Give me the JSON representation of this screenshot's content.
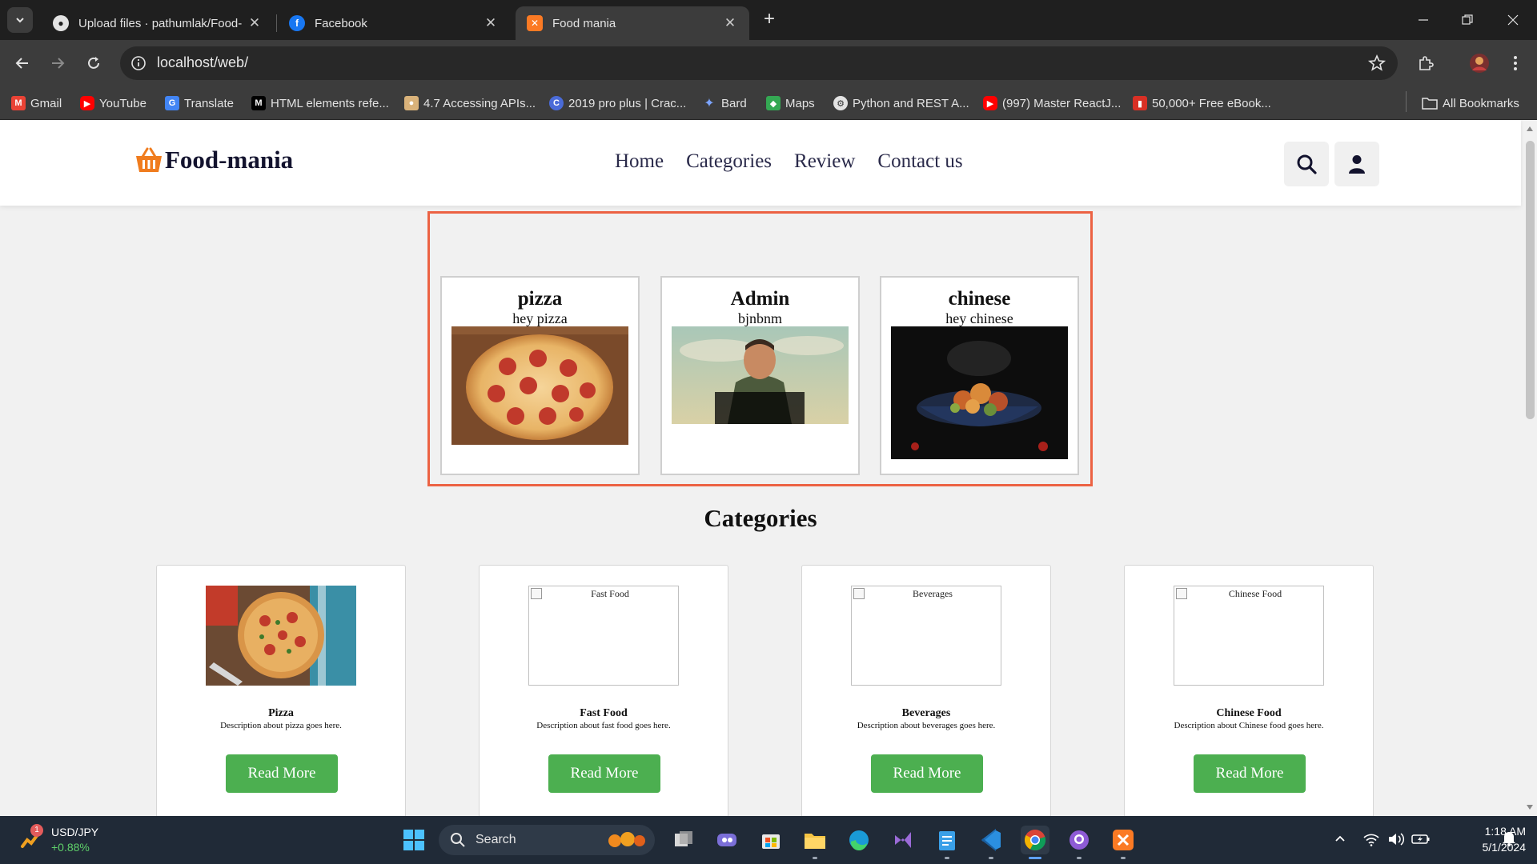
{
  "browser": {
    "tabs": [
      {
        "title": "Upload files · pathumlak/Food-",
        "icon": "github-icon"
      },
      {
        "title": "Facebook",
        "icon": "facebook-icon"
      },
      {
        "title": "Food mania",
        "icon": "xampp-icon"
      }
    ],
    "url": "localhost/web/",
    "bookmarks": [
      {
        "label": "Gmail",
        "icon": "gmail-icon"
      },
      {
        "label": "YouTube",
        "icon": "youtube-icon"
      },
      {
        "label": "Translate",
        "icon": "translate-icon"
      },
      {
        "label": "HTML elements refe...",
        "icon": "mdn-icon"
      },
      {
        "label": "4.7 Accessing APIs...",
        "icon": "course-icon"
      },
      {
        "label": "2019 pro plus | Crac...",
        "icon": "crack-icon"
      },
      {
        "label": "Bard",
        "icon": "bard-icon"
      },
      {
        "label": "Maps",
        "icon": "maps-icon"
      },
      {
        "label": "Python and REST A...",
        "icon": "python-icon"
      },
      {
        "label": "(997) Master ReactJ...",
        "icon": "youtube-icon"
      },
      {
        "label": "50,000+ Free eBook...",
        "icon": "ebook-icon"
      }
    ],
    "all_bookmarks": "All Bookmarks"
  },
  "site": {
    "logo": "Food-mania",
    "nav": [
      "Home",
      "Categories",
      "Review",
      "Contact us"
    ]
  },
  "featured": [
    {
      "title": "pizza",
      "subtitle": "hey pizza"
    },
    {
      "title": "Admin",
      "subtitle": "bjnbnm"
    },
    {
      "title": "chinese",
      "subtitle": "hey chinese"
    }
  ],
  "categories": {
    "heading": "Categories",
    "items": [
      {
        "name": "Pizza",
        "alt": "",
        "desc": "Description about pizza goes here.",
        "button": "Read More"
      },
      {
        "name": "Fast Food",
        "alt": "Fast Food",
        "desc": "Description about fast food goes here.",
        "button": "Read More"
      },
      {
        "name": "Beverages",
        "alt": "Beverages",
        "desc": "Description about beverages goes here.",
        "button": "Read More"
      },
      {
        "name": "Chinese Food",
        "alt": "Chinese Food",
        "desc": "Description about Chinese food goes here.",
        "button": "Read More"
      }
    ]
  },
  "taskbar": {
    "ticker_symbol": "USD/JPY",
    "ticker_change": "+0.88%",
    "ticker_badge": "1",
    "search_label": "Search",
    "time": "1:18 AM",
    "date": "5/1/2024"
  },
  "colors": {
    "accent_green": "#4caf50",
    "featured_border": "#ec6243",
    "logo_orange": "#f07c1e"
  }
}
